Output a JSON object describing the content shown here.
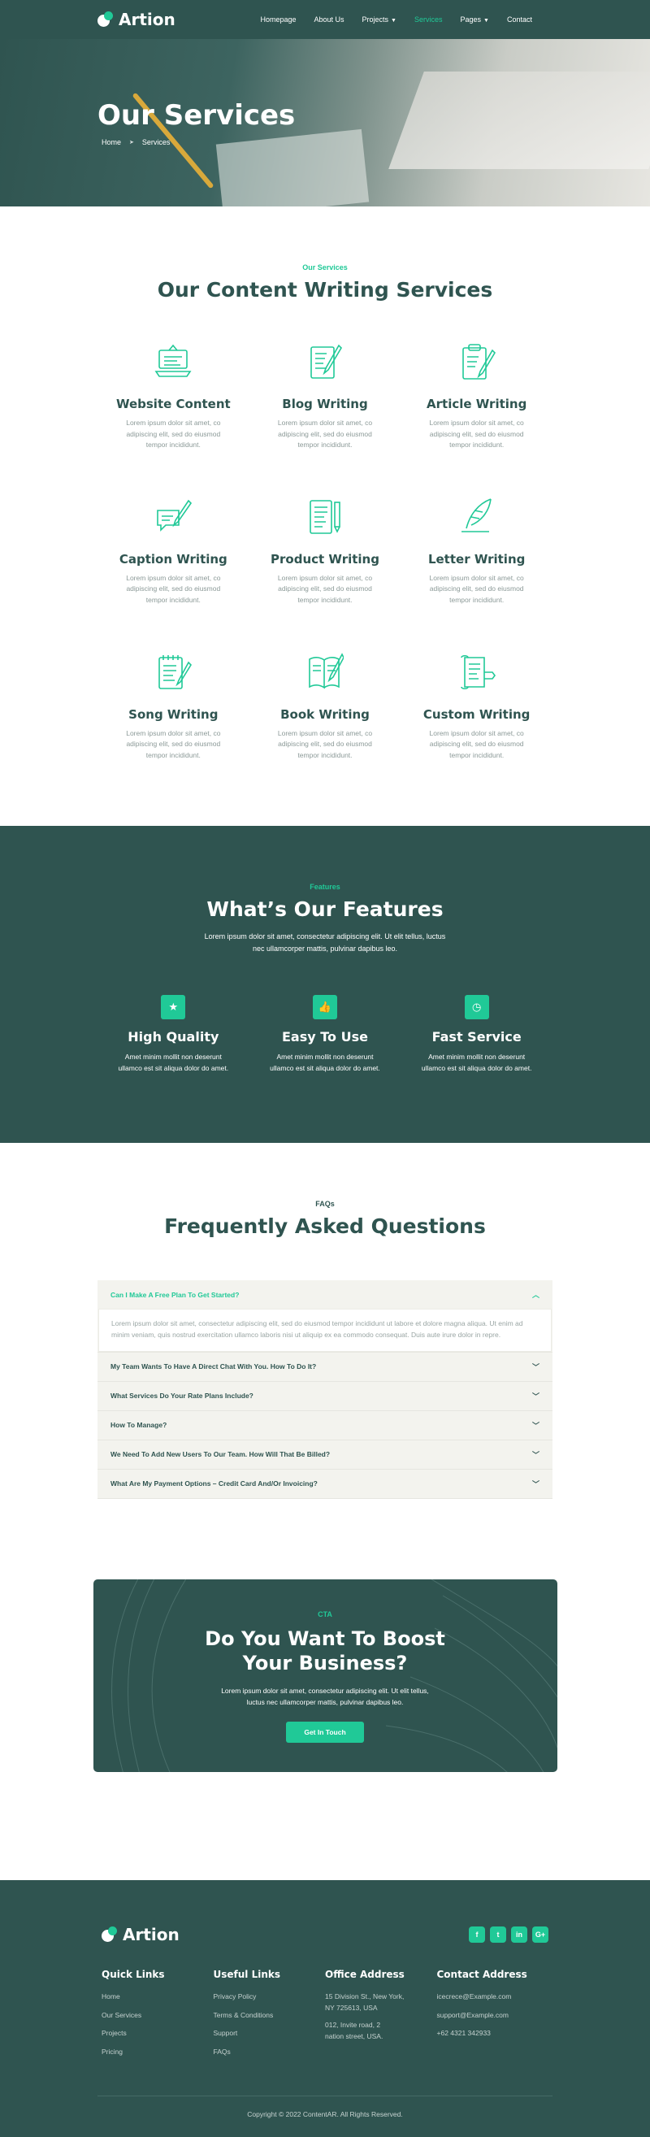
{
  "header": {
    "brand": "Artion",
    "nav": [
      {
        "label": "Homepage",
        "dropdown": false,
        "active": false
      },
      {
        "label": "About Us",
        "dropdown": false,
        "active": false
      },
      {
        "label": "Projects",
        "dropdown": true,
        "active": false
      },
      {
        "label": "Services",
        "dropdown": false,
        "active": true
      },
      {
        "label": "Pages",
        "dropdown": true,
        "active": false
      },
      {
        "label": "Contact",
        "dropdown": false,
        "active": false
      }
    ]
  },
  "hero": {
    "title": "Our Services",
    "breadcrumb": [
      "Home",
      "Services"
    ]
  },
  "services": {
    "eyebrow": "Our Services",
    "title": "Our Content Writing Services",
    "items": [
      {
        "icon": "laptop-icon",
        "title": "Website Content",
        "text": "Lorem ipsum dolor sit amet, co adipiscing elit, sed do eiusmod tempor incididunt."
      },
      {
        "icon": "blog-pen-icon",
        "title": "Blog Writing",
        "text": "Lorem ipsum dolor sit amet, co adipiscing elit, sed do eiusmod tempor incididunt."
      },
      {
        "icon": "clipboard-pen-icon",
        "title": "Article Writing",
        "text": "Lorem ipsum dolor sit amet, co adipiscing elit, sed do eiusmod tempor incididunt."
      },
      {
        "icon": "caption-icon",
        "title": "Caption Writing",
        "text": "Lorem ipsum dolor sit amet, co adipiscing elit, sed do eiusmod tempor incididunt."
      },
      {
        "icon": "product-doc-icon",
        "title": "Product Writing",
        "text": "Lorem ipsum dolor sit amet, co adipiscing elit, sed do eiusmod tempor incididunt."
      },
      {
        "icon": "quill-icon",
        "title": "Letter Writing",
        "text": "Lorem ipsum dolor sit amet, co adipiscing elit, sed do eiusmod tempor incididunt."
      },
      {
        "icon": "notepad-icon",
        "title": "Song Writing",
        "text": "Lorem ipsum dolor sit amet, co adipiscing elit, sed do eiusmod tempor incididunt."
      },
      {
        "icon": "book-icon",
        "title": "Book Writing",
        "text": "Lorem ipsum dolor sit amet, co adipiscing elit, sed do eiusmod tempor incididunt."
      },
      {
        "icon": "scroll-pen-icon",
        "title": "Custom Writing",
        "text": "Lorem ipsum dolor sit amet, co adipiscing elit, sed do eiusmod tempor incididunt."
      }
    ]
  },
  "features": {
    "eyebrow": "Features",
    "title": "What’s Our Features",
    "lead": "Lorem ipsum dolor sit amet, consectetur adipiscing elit. Ut elit tellus, luctus nec ullamcorper mattis, pulvinar dapibus leo.",
    "items": [
      {
        "icon": "star-icon",
        "glyph": "★",
        "title": "High Quality",
        "text": "Amet minim mollit non deserunt ullamco est sit aliqua dolor do amet."
      },
      {
        "icon": "thumbs-up-icon",
        "glyph": "👍",
        "title": "Easy To Use",
        "text": "Amet minim mollit non deserunt ullamco est sit aliqua dolor do amet."
      },
      {
        "icon": "clock-icon",
        "glyph": "◷",
        "title": "Fast Service",
        "text": "Amet minim mollit non deserunt ullamco est sit aliqua dolor do amet."
      }
    ]
  },
  "faqs": {
    "eyebrow": "FAQs",
    "title": "Frequently Asked Questions",
    "items": [
      {
        "q": "Can I Make A Free Plan To Get Started?",
        "open": true,
        "a": "Lorem ipsum dolor sit amet, consectetur adipiscing elit, sed do eiusmod tempor incididunt ut labore et dolore magna aliqua. Ut enim ad minim veniam, quis nostrud exercitation ullamco laboris nisi ut aliquip ex ea commodo consequat. Duis aute irure dolor in repre."
      },
      {
        "q": "My Team Wants To Have A Direct Chat With You. How To Do It?",
        "open": false
      },
      {
        "q": "What Services Do Your Rate Plans Include?",
        "open": false
      },
      {
        "q": "How To Manage?",
        "open": false
      },
      {
        "q": "We Need To Add New Users To Our Team. How Will That Be Billed?",
        "open": false
      },
      {
        "q": "What Are My Payment Options – Credit Card And/Or Invoicing?",
        "open": false
      }
    ]
  },
  "cta": {
    "eyebrow": "CTA",
    "title": "Do You Want To Boost Your Business?",
    "text": "Lorem ipsum dolor sit amet, consectetur adipiscing elit. Ut elit tellus, luctus nec ullamcorper mattis, pulvinar dapibus leo.",
    "button": "Get In Touch"
  },
  "footer": {
    "brand": "Artion",
    "socials": [
      {
        "icon": "facebook-icon",
        "glyph": "f"
      },
      {
        "icon": "twitter-icon",
        "glyph": "t"
      },
      {
        "icon": "linkedin-icon",
        "glyph": "in"
      },
      {
        "icon": "google-plus-icon",
        "glyph": "G+"
      }
    ],
    "columns": [
      {
        "title": "Quick Links",
        "links": [
          "Home",
          "Our Services",
          "Projects",
          "Pricing"
        ]
      },
      {
        "title": "Useful Links",
        "links": [
          "Privacy Policy",
          "Terms & Conditions",
          "Support",
          "FAQs"
        ]
      },
      {
        "title": "Office Address",
        "links": [
          "15 Division St., New York, NY 725613, USA",
          "012, Invite road, 2 nation street, USA."
        ]
      },
      {
        "title": "Contact Address",
        "links": [
          "icecrece@Example.com",
          "support@Example.com",
          "+62 4321 342933"
        ]
      }
    ],
    "copyright": "Copyright © 2022 ContentAR. All Rights Reserved."
  },
  "colors": {
    "primary": "#2f5450",
    "accent": "#20c997",
    "muted": "#8c9a98",
    "faq_bg": "#f3f3ee"
  }
}
